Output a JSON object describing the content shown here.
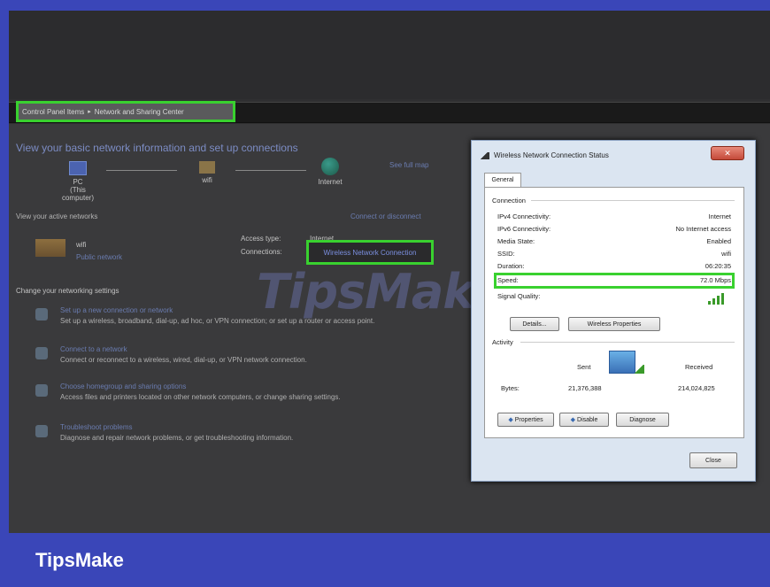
{
  "breadcrumb": {
    "item1": "Control Panel Items",
    "separator": "▸",
    "item2": "Network and Sharing Center"
  },
  "main": {
    "heading": "View your basic network information and set up connections",
    "see_full_map": "See full map",
    "nodes": [
      {
        "label": "PC",
        "sub": "(This computer)"
      },
      {
        "label": "wifi"
      },
      {
        "label": "Internet"
      }
    ],
    "view_active": "View your active networks",
    "connect_disconnect": "Connect or disconnect",
    "network_name": "wifi",
    "network_type": "Public network",
    "access_type_label": "Access type:",
    "access_type_value": "Internet",
    "connections_label": "Connections:",
    "connection_link": "Wireless Network Connection",
    "change_settings": "Change your networking settings",
    "tasks": [
      {
        "title": "Set up a new connection or network",
        "desc": "Set up a wireless, broadband, dial-up, ad hoc, or VPN connection; or set up a router or access point."
      },
      {
        "title": "Connect to a network",
        "desc": "Connect or reconnect to a wireless, wired, dial-up, or VPN network connection."
      },
      {
        "title": "Choose homegroup and sharing options",
        "desc": "Access files and printers located on other network computers, or change sharing settings."
      },
      {
        "title": "Troubleshoot problems",
        "desc": "Diagnose and repair network problems, or get troubleshooting information."
      }
    ]
  },
  "watermark": "TipsMake",
  "dialog": {
    "title": "Wireless Network Connection Status",
    "close_x": "✕",
    "tab": "General",
    "connection_group": "Connection",
    "rows": [
      {
        "k": "IPv4 Connectivity:",
        "v": "Internet"
      },
      {
        "k": "IPv6 Connectivity:",
        "v": "No Internet access"
      },
      {
        "k": "Media State:",
        "v": "Enabled"
      },
      {
        "k": "SSID:",
        "v": "wifi"
      },
      {
        "k": "Duration:",
        "v": "06:20:35"
      },
      {
        "k": "Speed:",
        "v": "72.0 Mbps"
      },
      {
        "k": "Signal Quality:",
        "v": ""
      }
    ],
    "details_btn": "Details...",
    "wireless_props_btn": "Wireless Properties",
    "activity_group": "Activity",
    "sent_label": "Sent",
    "received_label": "Received",
    "bytes_label": "Bytes:",
    "bytes_sent": "21,376,388",
    "bytes_received": "214,024,825",
    "properties_btn": "Properties",
    "disable_btn": "Disable",
    "diagnose_btn": "Diagnose",
    "close_btn": "Close"
  },
  "brand": {
    "label": "TipsMake",
    "color": "#3a46b8",
    "highlight": "#39d12f"
  }
}
